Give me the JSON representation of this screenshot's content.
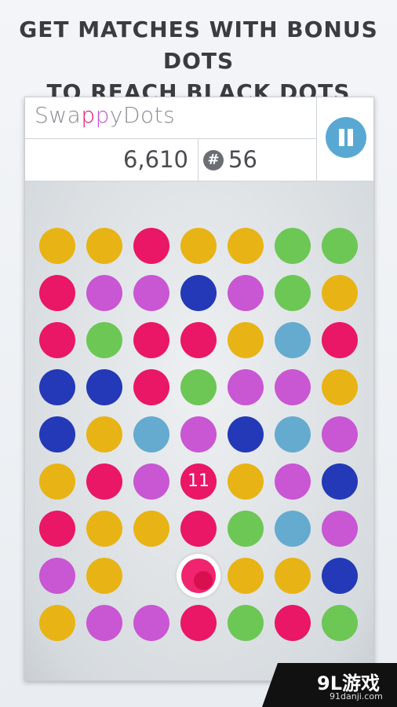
{
  "headline": {
    "line1": "GET MATCHES WITH BONUS DOTS",
    "line2": "TO REACH BLACK DOTS"
  },
  "hud": {
    "logo_pre": "Swa",
    "logo_p1": "p",
    "logo_p2": "p",
    "logo_post": "yDots",
    "score": "6,610",
    "moves_icon": "#",
    "moves": "56",
    "pause_icon": "pause-icon"
  },
  "colors": {
    "Y": "#e8b415",
    "R": "#ea1666",
    "P": "#c956d3",
    "G": "#6cc755",
    "B": "#2339b7",
    "L": "#64abcf"
  },
  "board": {
    "rows": [
      [
        "Y",
        "Y",
        "R",
        "Y",
        "Y",
        "G",
        "G"
      ],
      [
        "R",
        "P",
        "P",
        "B",
        "P",
        "G",
        "Y"
      ],
      [
        "R",
        "G",
        "R",
        "R",
        "Y",
        "L",
        "R"
      ],
      [
        "B",
        "B",
        "R",
        "G",
        "P",
        "P",
        "Y"
      ],
      [
        "B",
        "Y",
        "L",
        "P",
        "B",
        "L",
        "P"
      ],
      [
        "Y",
        "R",
        "P",
        "R*",
        "Y",
        "P",
        "B"
      ],
      [
        "R",
        "Y",
        "Y",
        "R",
        "G",
        "L",
        "P"
      ],
      [
        "P",
        "Y",
        "",
        "S",
        "Y",
        "Y",
        "B"
      ],
      [
        "Y",
        "P",
        "P",
        "R",
        "G",
        "R",
        "G"
      ]
    ],
    "bomb_label": "11"
  },
  "watermark": {
    "text": "9L游戏",
    "sub": "91danji.com"
  }
}
